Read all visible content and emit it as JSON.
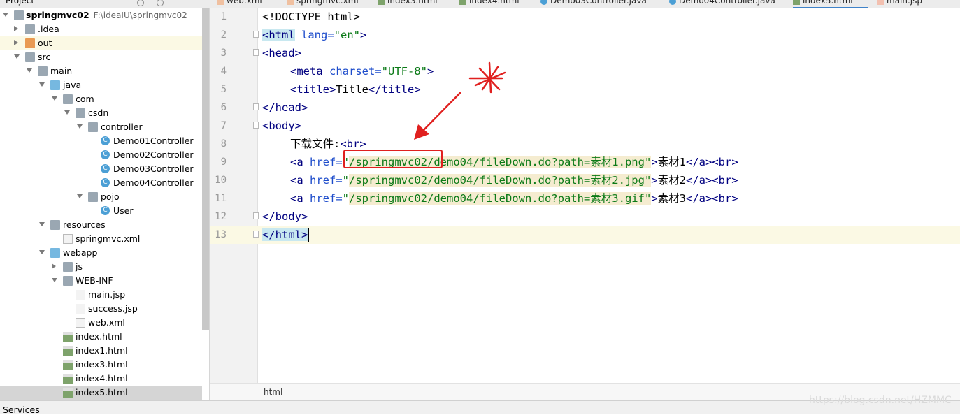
{
  "project_panel": {
    "title": "Project",
    "root": {
      "name": "springmvc02",
      "path": "F:\\ideaIU\\springmvc02"
    },
    "items": [
      {
        "label": ".idea",
        "icon": "folder-icon"
      },
      {
        "label": "out",
        "icon": "folder-orange-icon"
      },
      {
        "label": "src",
        "icon": "folder-icon"
      },
      {
        "label": "main",
        "icon": "folder-icon"
      },
      {
        "label": "java",
        "icon": "source-folder-icon"
      },
      {
        "label": "com",
        "icon": "package-icon"
      },
      {
        "label": "csdn",
        "icon": "package-icon"
      },
      {
        "label": "controller",
        "icon": "package-icon"
      },
      {
        "label": "Demo01Controller",
        "icon": "class-icon"
      },
      {
        "label": "Demo02Controller",
        "icon": "class-icon"
      },
      {
        "label": "Demo03Controller",
        "icon": "class-icon"
      },
      {
        "label": "Demo04Controller",
        "icon": "class-icon"
      },
      {
        "label": "pojo",
        "icon": "package-icon"
      },
      {
        "label": "User",
        "icon": "class-icon"
      },
      {
        "label": "resources",
        "icon": "resources-folder-icon"
      },
      {
        "label": "springmvc.xml",
        "icon": "xml-file-icon"
      },
      {
        "label": "webapp",
        "icon": "web-folder-icon"
      },
      {
        "label": "js",
        "icon": "folder-icon"
      },
      {
        "label": "WEB-INF",
        "icon": "folder-icon"
      },
      {
        "label": "main.jsp",
        "icon": "jsp-file-icon"
      },
      {
        "label": "success.jsp",
        "icon": "jsp-file-icon"
      },
      {
        "label": "web.xml",
        "icon": "xml-file-icon"
      },
      {
        "label": "index.html",
        "icon": "html-file-icon"
      },
      {
        "label": "index1.html",
        "icon": "html-file-icon"
      },
      {
        "label": "index3.html",
        "icon": "html-file-icon"
      },
      {
        "label": "index4.html",
        "icon": "html-file-icon"
      },
      {
        "label": "index5.html",
        "icon": "html-file-icon"
      }
    ]
  },
  "editor_tabs": [
    {
      "label": "web.xml"
    },
    {
      "label": "springmvc.xml"
    },
    {
      "label": "index3.html"
    },
    {
      "label": "index4.html"
    },
    {
      "label": "Demo03Controller.java"
    },
    {
      "label": "Demo04Controller.java"
    },
    {
      "label": "index5.html"
    },
    {
      "label": "main.jsp"
    }
  ],
  "editor": {
    "line_numbers": [
      "1",
      "2",
      "3",
      "4",
      "5",
      "6",
      "7",
      "8",
      "9",
      "10",
      "11",
      "12",
      "13"
    ],
    "current_line": "13",
    "lines": {
      "l1": "<!DOCTYPE html>",
      "l2_open": "<html",
      "l2_attr": " lang=",
      "l2_val": "\"en\"",
      "l2_close": ">",
      "l3": "<head>",
      "l4_open": "<meta",
      "l4_attr": " charset=",
      "l4_val": "\"UTF-8\"",
      "l4_close": ">",
      "l5_open": "<title>",
      "l5_text": "Title",
      "l5_close": "</title>",
      "l6": "</head>",
      "l7": "<body>",
      "l8_text": "下载文件:",
      "l8_tag": "<br>",
      "l9_open": "<a",
      "l9_attr": " href=",
      "l9_q": "\"",
      "l9_path": "/springmvc02/",
      "l9_rest": "demo04/fileDown.do?path=素材1.png\"",
      "l9_tagclose": ">",
      "l9_text": "素材1",
      "l9_end": "</a><br>",
      "l10_open": "<a",
      "l10_attr": " href=",
      "l10_q": "\"",
      "l10_path": "/springmvc02/demo04/fileDown.do?path=素材2.jpg\"",
      "l10_tagclose": ">",
      "l10_text": "素材2",
      "l10_end": "</a><br>",
      "l11_open": "<a",
      "l11_attr": " href=",
      "l11_q": "\"",
      "l11_path": "/springmvc02/demo04/fileDown.do?path=素材3.gif\"",
      "l11_tagclose": ">",
      "l11_text": "素材3",
      "l11_end": "</a><br>",
      "l12": "</body>",
      "l13": "</html>"
    }
  },
  "breadcrumb": "html",
  "status_bar": {
    "services": "Services"
  },
  "watermark": "https://blog.csdn.net/HZMMC",
  "colors": {
    "annotation": "#e0201f",
    "tag": "#000080",
    "attr": "#1d4ccb",
    "value": "#0b7a17",
    "current_line": "#fbf9e4",
    "selection": "#d5d5d5"
  }
}
